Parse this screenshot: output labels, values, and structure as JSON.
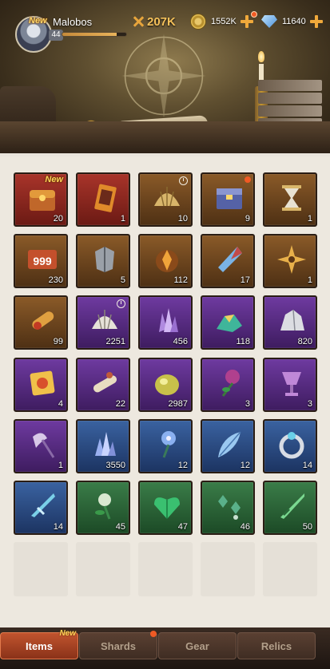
{
  "player": {
    "name": "Malobos",
    "level": "44",
    "new_label": "New",
    "power": "207K",
    "xp_fraction": 0.85
  },
  "currencies": {
    "gold": "1552K",
    "gems": "11640"
  },
  "colors": {
    "red": "#8e2a22",
    "brown": "#7a4a1e",
    "purple": "#5b2f86",
    "blue": "#2d4f86",
    "green": "#2f6a3c",
    "accent": "#f05a24"
  },
  "items": [
    {
      "name": "treasure-chest",
      "rarity": "red",
      "count": "20",
      "tag": "New"
    },
    {
      "name": "card-pack",
      "rarity": "red",
      "count": "1"
    },
    {
      "name": "shell-gold",
      "rarity": "brown",
      "count": "10",
      "timer": true
    },
    {
      "name": "equipment-chest",
      "rarity": "brown",
      "count": "9",
      "dot": true
    },
    {
      "name": "hourglass",
      "rarity": "brown",
      "count": "1"
    },
    {
      "name": "ticket-999",
      "rarity": "brown",
      "count": "230"
    },
    {
      "name": "armor-fragment",
      "rarity": "brown",
      "count": "5"
    },
    {
      "name": "ember-stone",
      "rarity": "brown",
      "count": "112"
    },
    {
      "name": "crystal-shard",
      "rarity": "brown",
      "count": "17"
    },
    {
      "name": "star-emblem",
      "rarity": "brown",
      "count": "1"
    },
    {
      "name": "fire-scroll",
      "rarity": "brown",
      "count": "99"
    },
    {
      "name": "shell-silver",
      "rarity": "purple",
      "count": "2251",
      "timer": true
    },
    {
      "name": "amethyst-cluster",
      "rarity": "purple",
      "count": "456"
    },
    {
      "name": "teal-ore",
      "rarity": "purple",
      "count": "118"
    },
    {
      "name": "silver-ore",
      "rarity": "purple",
      "count": "820"
    },
    {
      "name": "sun-talisman",
      "rarity": "purple",
      "count": "4"
    },
    {
      "name": "rolled-scroll",
      "rarity": "purple",
      "count": "22"
    },
    {
      "name": "gold-ore",
      "rarity": "purple",
      "count": "2987"
    },
    {
      "name": "purple-flower",
      "rarity": "purple",
      "count": "3"
    },
    {
      "name": "purple-chalice",
      "rarity": "purple",
      "count": "3"
    },
    {
      "name": "battle-axe",
      "rarity": "purple",
      "count": "1"
    },
    {
      "name": "blue-crystal",
      "rarity": "blue",
      "count": "3550"
    },
    {
      "name": "blue-flower",
      "rarity": "blue",
      "count": "12"
    },
    {
      "name": "blue-feather",
      "rarity": "blue",
      "count": "12"
    },
    {
      "name": "silver-ring",
      "rarity": "blue",
      "count": "14"
    },
    {
      "name": "ice-blade",
      "rarity": "blue",
      "count": "14"
    },
    {
      "name": "green-flower",
      "rarity": "green",
      "count": "45"
    },
    {
      "name": "emerald-heart",
      "rarity": "green",
      "count": "47"
    },
    {
      "name": "green-earrings",
      "rarity": "green",
      "count": "46"
    },
    {
      "name": "green-dagger",
      "rarity": "green",
      "count": "50"
    }
  ],
  "tabs": [
    {
      "label": "Items",
      "tag": "New",
      "active": true
    },
    {
      "label": "Shards",
      "dot": true
    },
    {
      "label": "Gear"
    },
    {
      "label": "Relics"
    }
  ]
}
